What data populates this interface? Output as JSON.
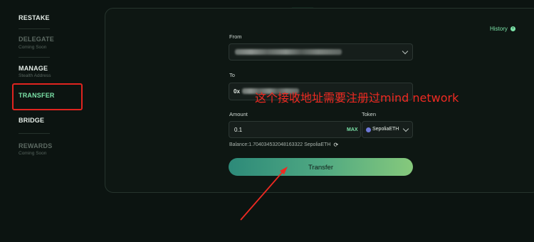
{
  "sidebar": {
    "items": [
      {
        "label": "RESTAKE",
        "sub": ""
      },
      {
        "label": "DELEGATE",
        "sub": "Coming Soon"
      },
      {
        "label": "MANAGE",
        "sub": "Stealth Address"
      },
      {
        "label": "TRANSFER",
        "sub": ""
      },
      {
        "label": "BRIDGE",
        "sub": ""
      },
      {
        "label": "REWARDS",
        "sub": "Coming Soon"
      }
    ],
    "active": "TRANSFER"
  },
  "card": {
    "history_label": "History",
    "from_label": "From",
    "from_value": "",
    "to_label": "To",
    "to_value_prefix": "0x",
    "amount_label": "Amount",
    "amount_value": "0.1",
    "max_label": "MAX",
    "token_label": "Token",
    "token_value": "SepoliaETH",
    "balance_text": "Balance:1.704034532048163322 SepoliaETH",
    "transfer_button": "Transfer"
  },
  "annotation": {
    "text": "这个接收地址需要注册过mind network",
    "color": "#ef2a22"
  },
  "colors": {
    "accent": "#7be3a8",
    "background": "#0c1411",
    "highlight_box": "#e0241f"
  }
}
